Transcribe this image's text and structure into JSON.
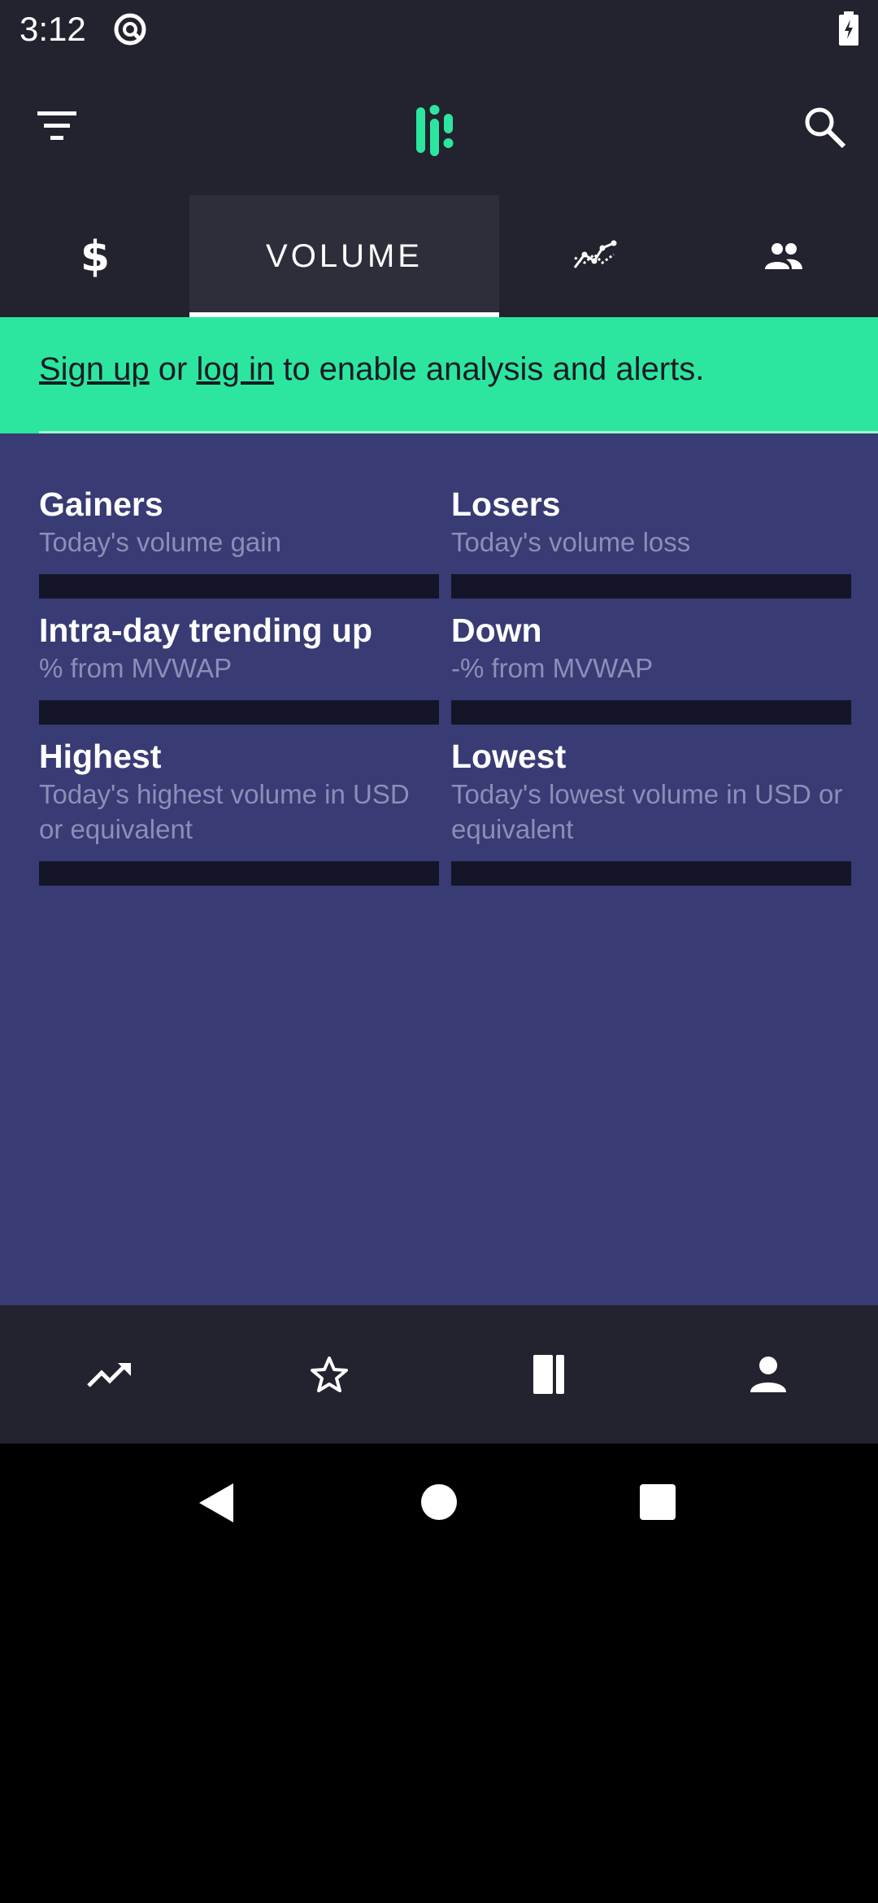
{
  "status_bar": {
    "time": "3:12"
  },
  "tabs": [
    {
      "id": "price",
      "label": "",
      "icon": "dollar-icon"
    },
    {
      "id": "volume",
      "label": "VOLUME",
      "active": true
    },
    {
      "id": "chart",
      "label": "",
      "icon": "line-chart-icon"
    },
    {
      "id": "social",
      "label": "",
      "icon": "people-icon"
    }
  ],
  "banner": {
    "signup": "Sign up",
    "or": " or ",
    "login": "log in",
    "rest": " to enable analysis and alerts."
  },
  "cards": [
    {
      "title": "Gainers",
      "subtitle": "Today's volume gain"
    },
    {
      "title": "Losers",
      "subtitle": "Today's volume loss"
    },
    {
      "title": "Intra-day trending up",
      "subtitle": "% from MVWAP"
    },
    {
      "title": "Down",
      "subtitle": "-% from MVWAP"
    },
    {
      "title": "Highest",
      "subtitle": "Today's highest volume in USD or equivalent"
    },
    {
      "title": "Lowest",
      "subtitle": "Today's lowest volume in USD or equivalent"
    }
  ],
  "bottom_nav": [
    {
      "icon": "trending-icon"
    },
    {
      "icon": "star-icon"
    },
    {
      "icon": "news-icon"
    },
    {
      "icon": "account-icon"
    }
  ],
  "colors": {
    "accent": "#2ce6a0",
    "content_bg": "#383b74",
    "bar_bg": "#23232f"
  }
}
